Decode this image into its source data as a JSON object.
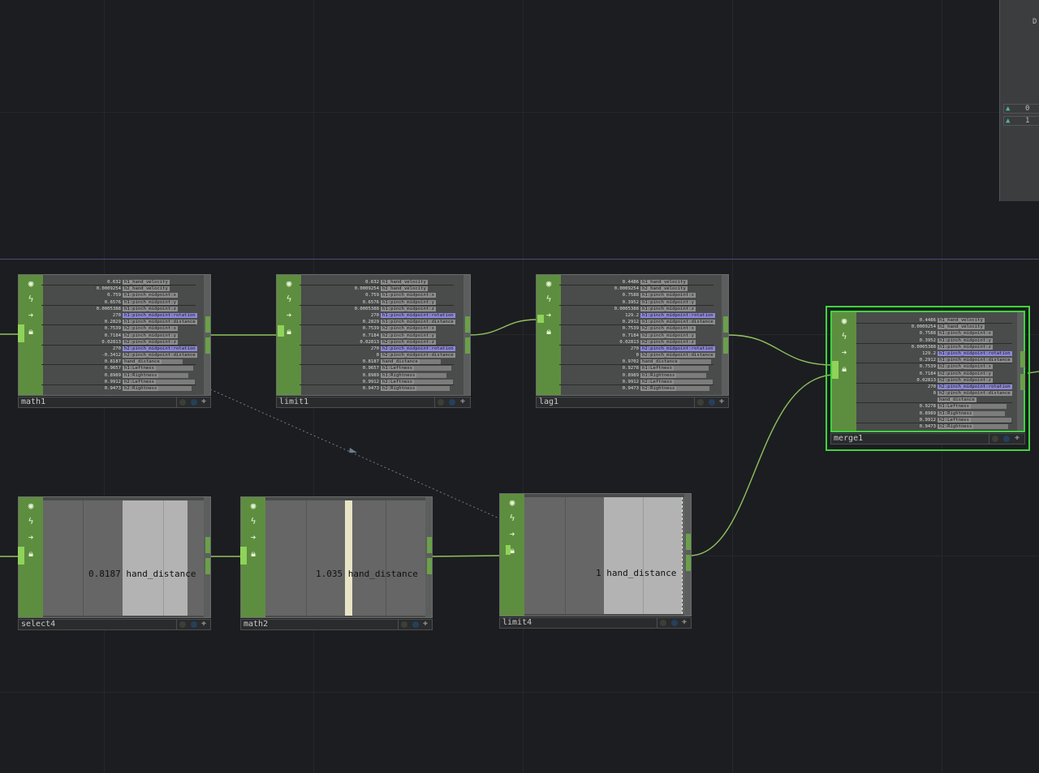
{
  "colors": {
    "operator_green": "#5d8e3f",
    "selected_border": "#3fd33f",
    "wire": "#8fc15f",
    "highlight_channel": "#8d88d8"
  },
  "icons": [
    "viewer-toggle-icon",
    "cook-flag-icon",
    "bypass-arrow-icon",
    "lock-icon"
  ],
  "side_panel": {
    "title_fragment": "D",
    "rows": [
      "0",
      "1"
    ]
  },
  "nodes": {
    "math1": {
      "name": "math1",
      "channels": [
        {
          "v": "0.632",
          "n": "h1_hand_velocity"
        },
        {
          "v": "0.0009254",
          "n": "h2_hand_velocity"
        },
        {
          "v": "0.759",
          "n": "h1:pinch_midpoint:x"
        },
        {
          "v": "0.6576",
          "n": "h1:pinch_midpoint:y"
        },
        {
          "v": "0.0005388",
          "n": "h1:pinch_midpoint:z"
        },
        {
          "v": "270",
          "n": "h1:pinch_midpoint:rotation"
        },
        {
          "v": "0.2829",
          "n": "h1:pinch_midpoint:distance"
        },
        {
          "v": "0.7539",
          "n": "h2:pinch_midpoint:x"
        },
        {
          "v": "0.7184",
          "n": "h2:pinch_midpoint:y"
        },
        {
          "v": "0.02813",
          "n": "h2:pinch_midpoint:z"
        },
        {
          "v": "270",
          "n": "h2:pinch_midpoint:rotation"
        },
        {
          "v": "-0.3412",
          "n": "h2:pinch_midpoint:distance"
        },
        {
          "v": "0.8187",
          "n": "hand_distance"
        },
        {
          "v": "0.9657",
          "n": "h1:Leftness"
        },
        {
          "v": "0.8989",
          "n": "h1:Rightness"
        },
        {
          "v": "0.9912",
          "n": "h2:Leftness"
        },
        {
          "v": "0.9473",
          "n": "h2:Rightness"
        }
      ]
    },
    "limit1": {
      "name": "limit1",
      "channels": [
        {
          "v": "0.632",
          "n": "h1_hand_velocity"
        },
        {
          "v": "0.0009254",
          "n": "h2_hand_velocity"
        },
        {
          "v": "0.759",
          "n": "h1:pinch_midpoint:x"
        },
        {
          "v": "0.6576",
          "n": "h1:pinch_midpoint:y"
        },
        {
          "v": "0.0005388",
          "n": "h1:pinch_midpoint:z"
        },
        {
          "v": "270",
          "n": "h1:pinch_midpoint:rotation"
        },
        {
          "v": "0.2829",
          "n": "h1:pinch_midpoint:distance"
        },
        {
          "v": "0.7539",
          "n": "h2:pinch_midpoint:x"
        },
        {
          "v": "0.7184",
          "n": "h2:pinch_midpoint:y"
        },
        {
          "v": "0.02813",
          "n": "h2:pinch_midpoint:z"
        },
        {
          "v": "270",
          "n": "h2:pinch_midpoint:rotation"
        },
        {
          "v": "0",
          "n": "h2:pinch_midpoint:distance"
        },
        {
          "v": "0.8187",
          "n": "hand_distance"
        },
        {
          "v": "0.9657",
          "n": "h1:Leftness"
        },
        {
          "v": "0.8989",
          "n": "h1:Rightness"
        },
        {
          "v": "0.9912",
          "n": "h2:Leftness"
        },
        {
          "v": "0.9473",
          "n": "h2:Rightness"
        }
      ]
    },
    "lag1": {
      "name": "lag1",
      "channels": [
        {
          "v": "0.4486",
          "n": "h1_hand_velocity"
        },
        {
          "v": "0.0009254",
          "n": "h2_hand_velocity"
        },
        {
          "v": "0.7588",
          "n": "h1:pinch_midpoint:x"
        },
        {
          "v": "0.3952",
          "n": "h1:pinch_midpoint:y"
        },
        {
          "v": "0.0005388",
          "n": "h1:pinch_midpoint:z"
        },
        {
          "v": "129.2",
          "n": "h1:pinch_midpoint:rotation"
        },
        {
          "v": "0.2912",
          "n": "h1:pinch_midpoint:distance"
        },
        {
          "v": "0.7539",
          "n": "h2:pinch_midpoint:x"
        },
        {
          "v": "0.7184",
          "n": "h2:pinch_midpoint:y"
        },
        {
          "v": "0.02813",
          "n": "h2:pinch_midpoint:z"
        },
        {
          "v": "270",
          "n": "h2:pinch_midpoint:rotation"
        },
        {
          "v": "0",
          "n": "h2:pinch_midpoint:distance"
        },
        {
          "v": "0.9702",
          "n": "hand_distance"
        },
        {
          "v": "0.9278",
          "n": "h1:Leftness"
        },
        {
          "v": "0.8989",
          "n": "h1:Rightness"
        },
        {
          "v": "0.9912",
          "n": "h2:Leftness"
        },
        {
          "v": "0.9473",
          "n": "h2:Rightness"
        }
      ]
    },
    "merge1": {
      "name": "merge1",
      "channels": [
        {
          "v": "0.4486",
          "n": "h1_hand_velocity"
        },
        {
          "v": "0.0009254",
          "n": "h2_hand_velocity"
        },
        {
          "v": "0.7588",
          "n": "h1:pinch_midpoint:x"
        },
        {
          "v": "0.3952",
          "n": "h1:pinch_midpoint:y"
        },
        {
          "v": "0.0005388",
          "n": "h1:pinch_midpoint:z"
        },
        {
          "v": "129.2",
          "n": "h1:pinch_midpoint:rotation"
        },
        {
          "v": "0.2912",
          "n": "h1:pinch_midpoint:distance"
        },
        {
          "v": "0.7539",
          "n": "h2:pinch_midpoint:x"
        },
        {
          "v": "0.7184",
          "n": "h2:pinch_midpoint:y"
        },
        {
          "v": "0.02813",
          "n": "h2:pinch_midpoint:z"
        },
        {
          "v": "270",
          "n": "h2:pinch_midpoint:rotation"
        },
        {
          "v": "0",
          "n": "h2:pinch_midpoint:distance"
        },
        {
          "v": "",
          "n": "hand_distance"
        },
        {
          "v": "0.9278",
          "n": "h1:Leftness"
        },
        {
          "v": "0.8989",
          "n": "h1:Rightness"
        },
        {
          "v": "0.9912",
          "n": "h2:Leftness"
        },
        {
          "v": "0.9473",
          "n": "h2:Rightness"
        }
      ]
    },
    "select4": {
      "name": "select4",
      "value": "0.8187",
      "channel": "hand_distance"
    },
    "math2": {
      "name": "math2",
      "value": "1.035",
      "channel": "hand_distance"
    },
    "limit4": {
      "name": "limit4",
      "value": "1",
      "channel": "hand_distance"
    }
  }
}
